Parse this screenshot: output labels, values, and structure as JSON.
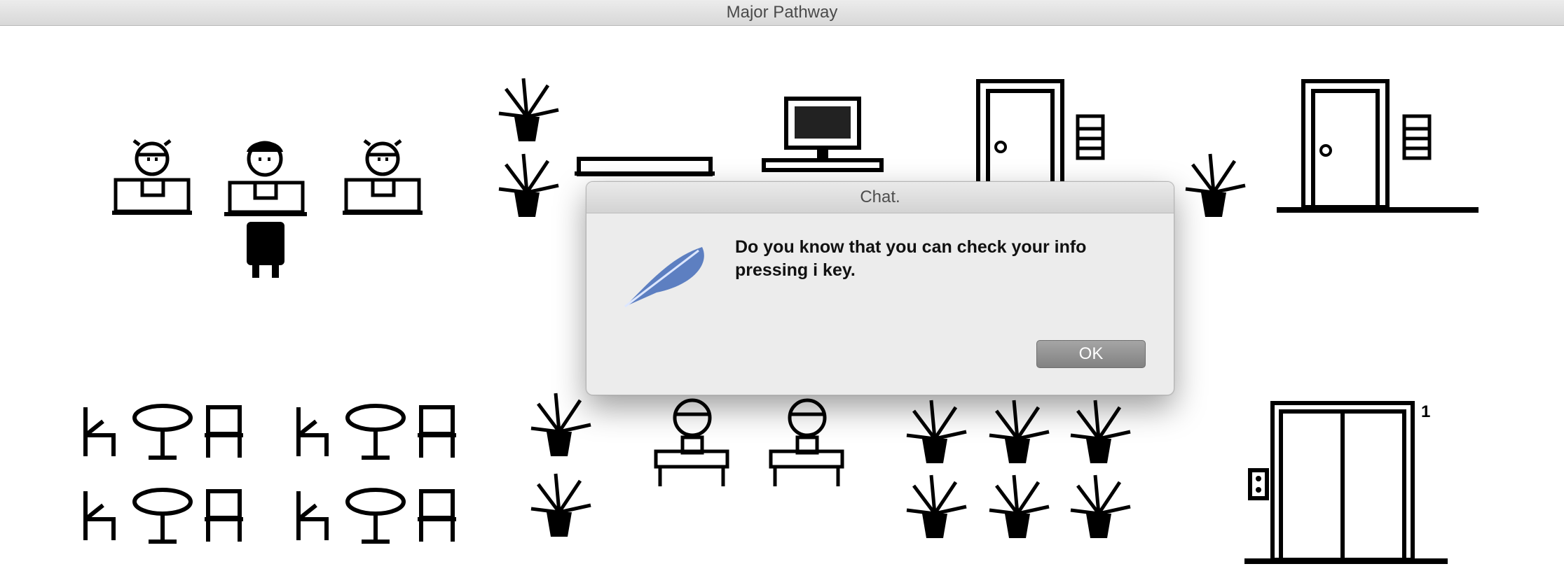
{
  "window": {
    "title": "Major Pathway"
  },
  "dialog": {
    "title": "Chat.",
    "message": "Do you know that you can check your info pressing i key.",
    "ok_label": "OK",
    "icon": "feather-icon"
  },
  "scene": {
    "elevator_floor_label": "1",
    "sprites": [
      "student-at-desk",
      "teacher-at-desk",
      "player-character",
      "potted-plant",
      "bench",
      "computer-desk",
      "door",
      "trash-bin",
      "cafe-table-set",
      "elevator",
      "elevator-call-button"
    ]
  },
  "colors": {
    "ink": "#000000",
    "screen": "#222222",
    "dialog_bg": "#ececec",
    "button": "#959595"
  }
}
